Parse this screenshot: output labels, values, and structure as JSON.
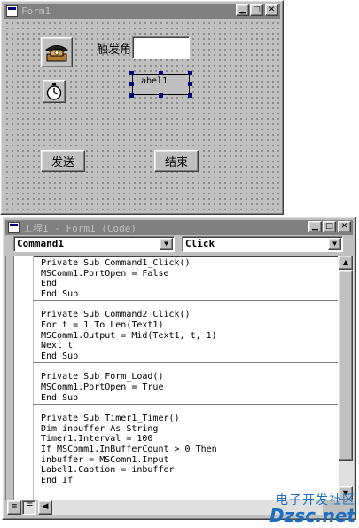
{
  "form_window": {
    "title": "Form1",
    "controls": {
      "label_trigger_angle": "触发角",
      "textbox_value": "",
      "label1_caption": "Label1",
      "send_button_label": "发送",
      "end_button_label": "结束"
    }
  },
  "code_window": {
    "title": "工程1 - Form1 (Code)",
    "object_combo": "Command1",
    "procedure_combo": "Click",
    "procedures": [
      [
        "Private Sub Command1_Click()",
        "MSComm1.PortOpen = False",
        "End",
        "End Sub"
      ],
      [
        "Private Sub Command2_Click()",
        "For t = 1 To Len(Text1)",
        "MSComm1.Output = Mid(Text1, t, 1)",
        "Next t",
        "End Sub"
      ],
      [
        "Private Sub Form_Load()",
        "MSComm1.PortOpen = True",
        "End Sub"
      ],
      [
        "Private Sub Timer1_Timer()",
        "Dim inbuffer As String",
        "Timer1.Interval = 100",
        "If MSComm1.InBufferCount > 0 Then",
        "inbuffer = MSComm1.Input",
        "Label1.Caption = inbuffer",
        "End If"
      ]
    ]
  },
  "icons": {
    "phone": "telephone-icon",
    "timer": "stopwatch-icon",
    "window_buttons": [
      "minimize",
      "maximize",
      "close"
    ]
  },
  "watermark": {
    "line1": "电子开发社区",
    "line2": "Dzsc.net"
  },
  "colors": {
    "face": "#c0c0c0",
    "inactive_title": "#808080",
    "selection_handle": "#000080"
  }
}
